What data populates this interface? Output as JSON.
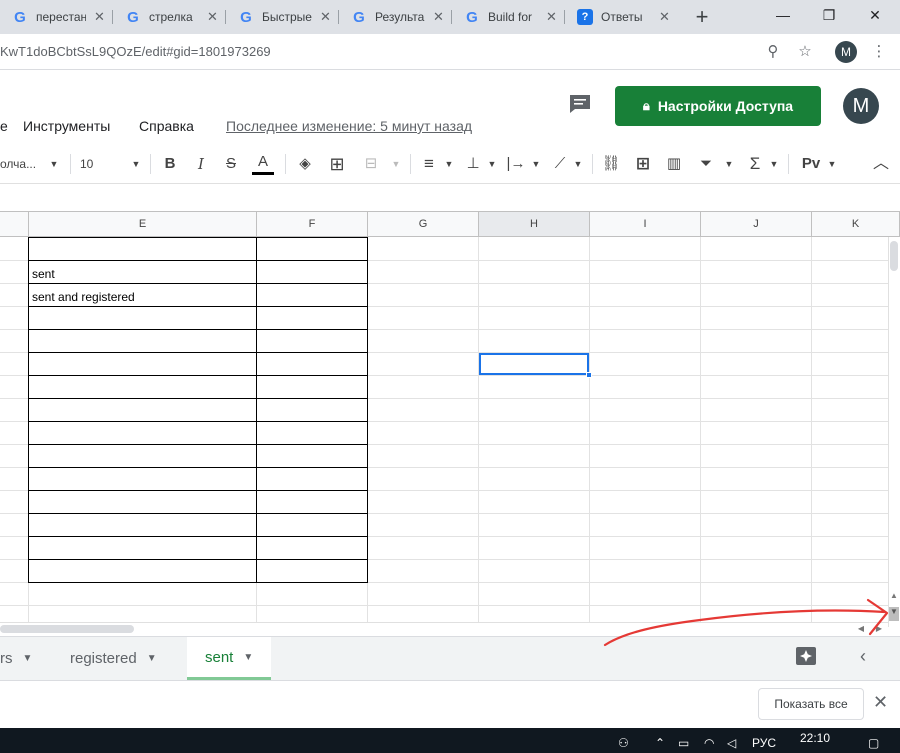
{
  "browser": {
    "tabs": [
      {
        "label": "перестан",
        "icon": "google-g-icon"
      },
      {
        "label": "стрелка",
        "icon": "google-g-icon"
      },
      {
        "label": "Быстрые",
        "icon": "google-g-icon"
      },
      {
        "label": "Результа",
        "icon": "google-g-icon"
      },
      {
        "label": "Build for",
        "icon": "google-g-icon"
      },
      {
        "label": "Ответы",
        "icon": "question-icon"
      }
    ],
    "url": "KwT1doBCbtSsL9QOzE/edit#gid=1801973269",
    "profile_initial": "M"
  },
  "docs": {
    "menu": [
      "е",
      "Инструменты",
      "Справка"
    ],
    "last_edit": "Последнее изменение: 5 минут назад",
    "share_label": "Настройки Доступа",
    "avatar_initial": "M"
  },
  "toolbar": {
    "font_name": "олча...",
    "font_size": "10",
    "bold": "B",
    "italic": "I",
    "strike": "S",
    "text_color": "A",
    "input_tools": "Pv"
  },
  "grid": {
    "columns": [
      "E",
      "F",
      "G",
      "H",
      "I",
      "J",
      "K"
    ],
    "cells": [
      "sent",
      "sent and registered"
    ]
  },
  "sheets": {
    "tabs": [
      "rs",
      "registered",
      "sent"
    ],
    "active": "sent"
  },
  "downloads": {
    "show_all": "Показать все"
  },
  "taskbar": {
    "lang": "РУС",
    "time": "22:10"
  },
  "colors": {
    "share_green": "#188038",
    "active_tab_underline": "#81c995",
    "selection_blue": "#1a73e8",
    "annotation_red": "#e53935"
  }
}
